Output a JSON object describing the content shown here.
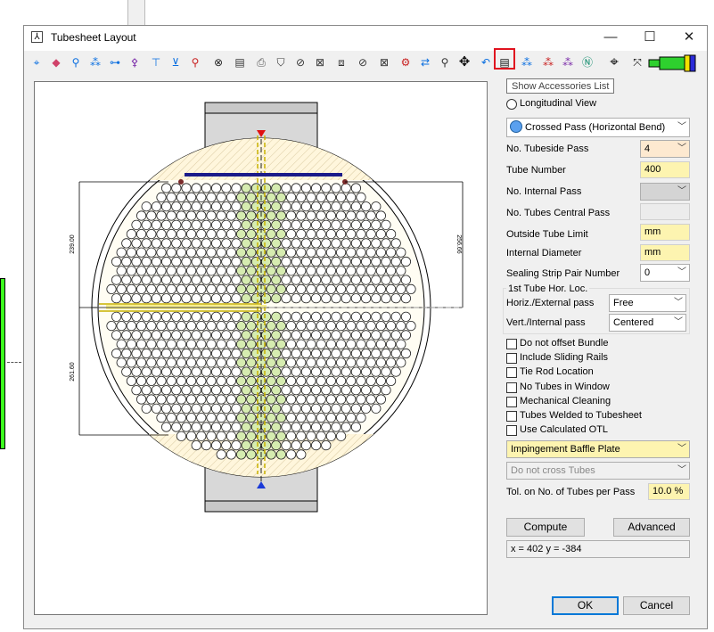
{
  "window": {
    "title": "Tubesheet Layout",
    "minimize": "—",
    "maximize": "☐",
    "close": "✕"
  },
  "tooltip": "Show Accessories List",
  "drawing": {
    "dim_top": "239.00",
    "dim_bottom": "261.60",
    "dim_right": "256.66"
  },
  "panel": {
    "longitudinal_view": "Longitudinal View",
    "pass_type": "Crossed Pass (Horizontal Bend)",
    "tubeside_pass_label": "No. Tubeside Pass",
    "tubeside_pass_value": "4",
    "tube_number_label": "Tube Number",
    "tube_number_value": "400",
    "internal_pass_label": "No. Internal Pass",
    "central_pass_label": "No. Tubes Central Pass",
    "otl_label": "Outside Tube Limit",
    "otl_value": "mm",
    "internal_diameter_label": "Internal Diameter",
    "internal_diameter_value": "mm",
    "sealing_strip_label": "Sealing Strip Pair Number",
    "sealing_strip_value": "0",
    "first_tube_group": "1st Tube Hor. Loc.",
    "horiz_label": "Horiz./External pass",
    "horiz_value": "Free",
    "vert_label": "Vert./Internal pass",
    "vert_value": "Centered",
    "checkboxes": [
      "Do not offset Bundle",
      "Include Sliding Rails",
      "Tie Rod Location",
      "No Tubes in Window",
      "Mechanical Cleaning",
      "Tubes Welded to Tubesheet",
      "Use Calculated OTL"
    ],
    "impingement": "Impingement Baffle Plate",
    "cross_tubes": "Do not cross Tubes",
    "tolerance_label": "Tol. on No. of Tubes per Pass",
    "tolerance_value": "10.0 %",
    "compute": "Compute",
    "advanced": "Advanced",
    "coords": "x = 402 y = -384",
    "ok": "OK",
    "cancel": "Cancel"
  },
  "toolbar": [
    "select-icon",
    "eraser-icon",
    "add-tube-icon",
    "add-tubes-icon",
    "tie-rod-icon",
    "plug-icon",
    "pin-icon",
    "marker-icon",
    "ring-icon",
    "bolt-icon",
    "report-icon",
    "print-icon",
    "shield-icon",
    "cross-icon",
    "cross-bold-icon",
    "frame-icon",
    "plate-icon",
    "block-icon",
    "merge-icon",
    "refresh-icon",
    "zoom-icon",
    "move-icon",
    "undo-icon",
    "accessories-list-icon",
    "dots-icon",
    "dots-red-icon",
    "dots-purple-icon",
    "n-icon",
    "crosshair-icon",
    "x-move-icon",
    "bundle-icon"
  ]
}
